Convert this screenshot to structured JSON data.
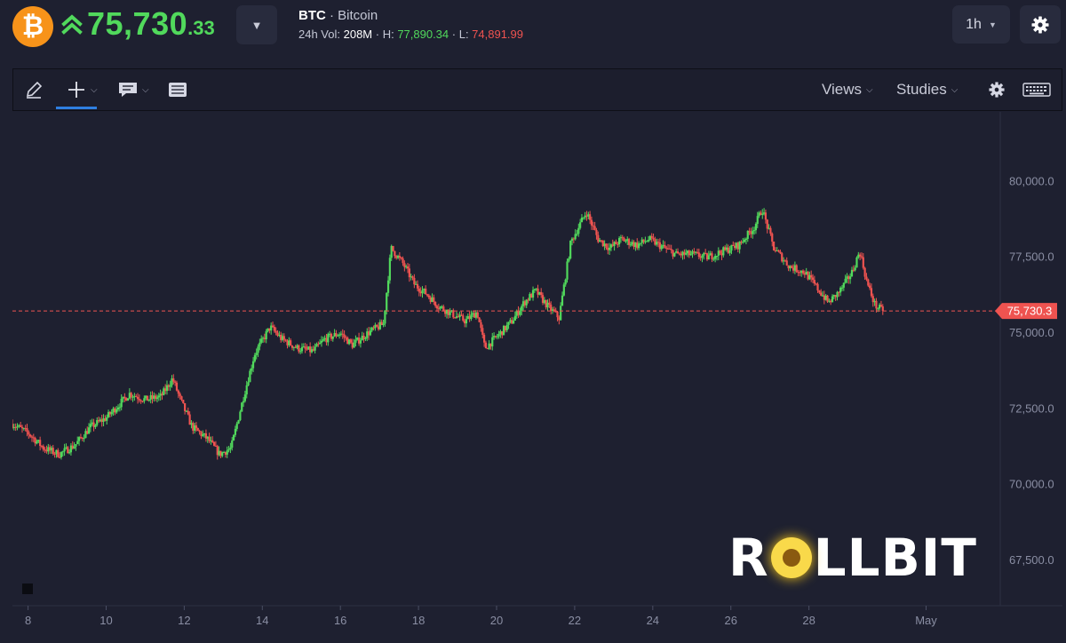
{
  "header": {
    "price_main": "75,730",
    "price_decimals": ".33",
    "symbol": "BTC",
    "separator": " · ",
    "name": "Bitcoin",
    "stats": {
      "vol_label": "24h Vol: ",
      "vol_value": "208M",
      "high_label": " · H: ",
      "high_value": "77,890.34",
      "low_label": " · L: ",
      "low_value": "74,891.99"
    },
    "dropdown_glyph": "▼",
    "timeframe": "1h",
    "timeframe_caret": "▼"
  },
  "toolbar": {
    "views_label": "Views",
    "studies_label": "Studies",
    "caret": "⌵"
  },
  "icons": [
    "bitcoin-icon",
    "double-chevron-up-icon",
    "pencil-icon",
    "crosshair-icon",
    "comment-icon",
    "list-icon",
    "gear-icon",
    "keyboard-icon"
  ],
  "colors": {
    "up": "#51d95c",
    "down": "#ef5350",
    "bitcoin": "#f7931a",
    "accent": "#2f7fe0"
  },
  "chart_data": {
    "type": "candlestick",
    "timeframe": "1h",
    "y_ticks": [
      "80,000.0",
      "77,500.0",
      "75,000.0",
      "72,500.0",
      "70,000.0",
      "67,500.0"
    ],
    "y_tick_values": [
      80000,
      77500,
      75000,
      72500,
      70000,
      67500
    ],
    "ylim": [
      66000,
      82300
    ],
    "x_ticks": [
      "8",
      "10",
      "12",
      "14",
      "16",
      "18",
      "20",
      "22",
      "24",
      "26",
      "28",
      "May"
    ],
    "x_tick_days": [
      8,
      10,
      12,
      14,
      16,
      18,
      20,
      22,
      24,
      26,
      28,
      31
    ],
    "xlim": [
      7.6,
      32.9
    ],
    "current_price": 75730.3,
    "current_price_label": "75,730.3",
    "close_series": [
      [
        7.6,
        72000
      ],
      [
        8.0,
        71700
      ],
      [
        8.4,
        71200
      ],
      [
        8.8,
        71000
      ],
      [
        9.2,
        71300
      ],
      [
        9.6,
        71900
      ],
      [
        10.0,
        72200
      ],
      [
        10.3,
        72600
      ],
      [
        10.6,
        73000
      ],
      [
        11.0,
        72800
      ],
      [
        11.4,
        72900
      ],
      [
        11.7,
        73500
      ],
      [
        11.9,
        72800
      ],
      [
        12.2,
        71900
      ],
      [
        12.6,
        71500
      ],
      [
        12.9,
        71000
      ],
      [
        13.2,
        71200
      ],
      [
        13.5,
        72800
      ],
      [
        13.8,
        74300
      ],
      [
        14.2,
        75200
      ],
      [
        14.5,
        74800
      ],
      [
        14.9,
        74500
      ],
      [
        15.3,
        74400
      ],
      [
        15.6,
        74800
      ],
      [
        16.0,
        75000
      ],
      [
        16.3,
        74600
      ],
      [
        16.7,
        75000
      ],
      [
        17.1,
        75300
      ],
      [
        17.3,
        77800
      ],
      [
        17.6,
        77300
      ],
      [
        17.9,
        76600
      ],
      [
        18.2,
        76300
      ],
      [
        18.5,
        75900
      ],
      [
        18.9,
        75600
      ],
      [
        19.2,
        75400
      ],
      [
        19.5,
        75700
      ],
      [
        19.7,
        74500
      ],
      [
        20.1,
        75000
      ],
      [
        20.4,
        75400
      ],
      [
        20.7,
        76000
      ],
      [
        21.0,
        76400
      ],
      [
        21.3,
        75900
      ],
      [
        21.6,
        75500
      ],
      [
        21.9,
        78000
      ],
      [
        22.3,
        79000
      ],
      [
        22.6,
        78100
      ],
      [
        22.9,
        77800
      ],
      [
        23.2,
        78100
      ],
      [
        23.6,
        77900
      ],
      [
        23.9,
        78100
      ],
      [
        24.3,
        77800
      ],
      [
        24.6,
        77600
      ],
      [
        25.0,
        77600
      ],
      [
        25.4,
        77500
      ],
      [
        25.8,
        77700
      ],
      [
        26.2,
        77900
      ],
      [
        26.6,
        78500
      ],
      [
        26.8,
        79100
      ],
      [
        27.1,
        77800
      ],
      [
        27.5,
        77200
      ],
      [
        27.9,
        77000
      ],
      [
        28.2,
        76500
      ],
      [
        28.5,
        76000
      ],
      [
        28.8,
        76400
      ],
      [
        29.1,
        77000
      ],
      [
        29.3,
        77700
      ],
      [
        29.5,
        76600
      ],
      [
        29.7,
        75900
      ],
      [
        29.9,
        75730
      ]
    ]
  },
  "logo": {
    "text_before": "R",
    "text_after": "LLBIT",
    "full": "ROLLBIT"
  }
}
